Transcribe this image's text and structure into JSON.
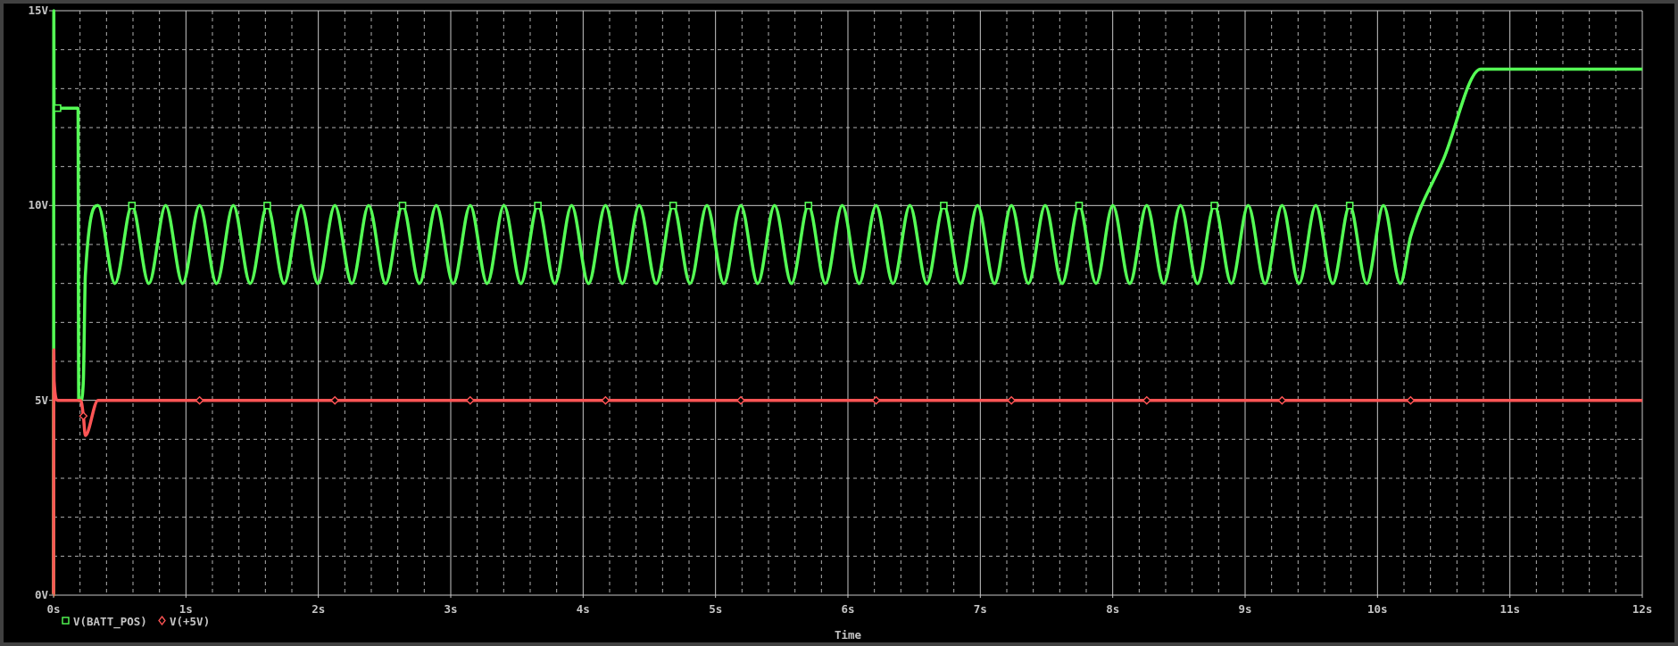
{
  "plot": {
    "chart_data": {
      "type": "line",
      "xlabel": "Time",
      "x": [
        0,
        0.002,
        0.004,
        0.03,
        0.185,
        0.19,
        0.205,
        0.225,
        0.24,
        0.336,
        0.464,
        0.592,
        0.72,
        0.847,
        0.975,
        1.103,
        1.231,
        1.358,
        1.486,
        1.614,
        1.742,
        1.869,
        1.997,
        2.125,
        2.253,
        2.38,
        2.508,
        2.636,
        2.764,
        2.891,
        3.019,
        3.147,
        3.275,
        3.402,
        3.53,
        3.658,
        3.786,
        3.913,
        4.041,
        4.169,
        4.297,
        4.424,
        4.552,
        4.68,
        4.808,
        4.935,
        5.063,
        5.191,
        5.319,
        5.446,
        5.574,
        5.702,
        5.83,
        5.957,
        6.085,
        6.213,
        6.341,
        6.468,
        6.596,
        6.724,
        6.852,
        6.979,
        7.107,
        7.235,
        7.363,
        7.49,
        7.618,
        7.746,
        7.874,
        8.001,
        8.129,
        8.257,
        8.385,
        8.512,
        8.64,
        8.768,
        8.896,
        9.023,
        9.151,
        9.279,
        9.407,
        9.534,
        9.662,
        9.79,
        9.918,
        10.045,
        10.173,
        10.25,
        10.5,
        10.78,
        12
      ],
      "series": [
        {
          "name": "V(BATT_POS)",
          "color": "#55ff55",
          "values": [
            0,
            15,
            12.5,
            12.5,
            12.5,
            5,
            5,
            5.5,
            8.2,
            10,
            8,
            10,
            8,
            10,
            8,
            10,
            8,
            10,
            8,
            10,
            8,
            10,
            8,
            10,
            8,
            10,
            8,
            10,
            8,
            10,
            8,
            10,
            8,
            10,
            8,
            10,
            8,
            10,
            8,
            10,
            8,
            10,
            8,
            10,
            8,
            10,
            8,
            10,
            8,
            10,
            8,
            10,
            8,
            10,
            8,
            10,
            8,
            10,
            8,
            10,
            8,
            10,
            8,
            10,
            8,
            10,
            8,
            10,
            8,
            10,
            8,
            10,
            8,
            10,
            8,
            10,
            8,
            10,
            8,
            10,
            8,
            10,
            8,
            10,
            8,
            10,
            8,
            9.2,
            11.2,
            13.5,
            13.5
          ]
        },
        {
          "name": "V(+5V)",
          "color": "#ff5555",
          "values": [
            0,
            6.3,
            5.5,
            5,
            5,
            5,
            5,
            4.6,
            4.1,
            5,
            5,
            5,
            5,
            5,
            5,
            5,
            5,
            5,
            5,
            5,
            5,
            5,
            5,
            5,
            5,
            5,
            5,
            5,
            5,
            5,
            5,
            5,
            5,
            5,
            5,
            5,
            5,
            5,
            5,
            5,
            5,
            5,
            5,
            5,
            5,
            5,
            5,
            5,
            5,
            5,
            5,
            5,
            5,
            5,
            5,
            5,
            5,
            5,
            5,
            5,
            5,
            5,
            5,
            5,
            5,
            5,
            5,
            5,
            5,
            5,
            5,
            5,
            5,
            5,
            5,
            5,
            5,
            5,
            5,
            5,
            5,
            5,
            5,
            5,
            5,
            5,
            5,
            5,
            5,
            5,
            5
          ]
        }
      ],
      "grid": true,
      "legend": "bottom-left",
      "xlim": [
        0,
        12
      ],
      "ylim": [
        0,
        15
      ],
      "xticks": [
        {
          "value": 0,
          "label": "0s"
        },
        {
          "value": 1,
          "label": "1s"
        },
        {
          "value": 2,
          "label": "2s"
        },
        {
          "value": 3,
          "label": "3s"
        },
        {
          "value": 4,
          "label": "4s"
        },
        {
          "value": 5,
          "label": "5s"
        },
        {
          "value": 6,
          "label": "6s"
        },
        {
          "value": 7,
          "label": "7s"
        },
        {
          "value": 8,
          "label": "8s"
        },
        {
          "value": 9,
          "label": "9s"
        },
        {
          "value": 10,
          "label": "10s"
        },
        {
          "value": 11,
          "label": "11s"
        },
        {
          "value": 12,
          "label": "12s"
        }
      ],
      "yticks": [
        {
          "value": 0,
          "label": "0V"
        },
        {
          "value": 5,
          "label": "5V"
        },
        {
          "value": 10,
          "label": "10V"
        },
        {
          "value": 15,
          "label": "15V"
        }
      ]
    }
  }
}
